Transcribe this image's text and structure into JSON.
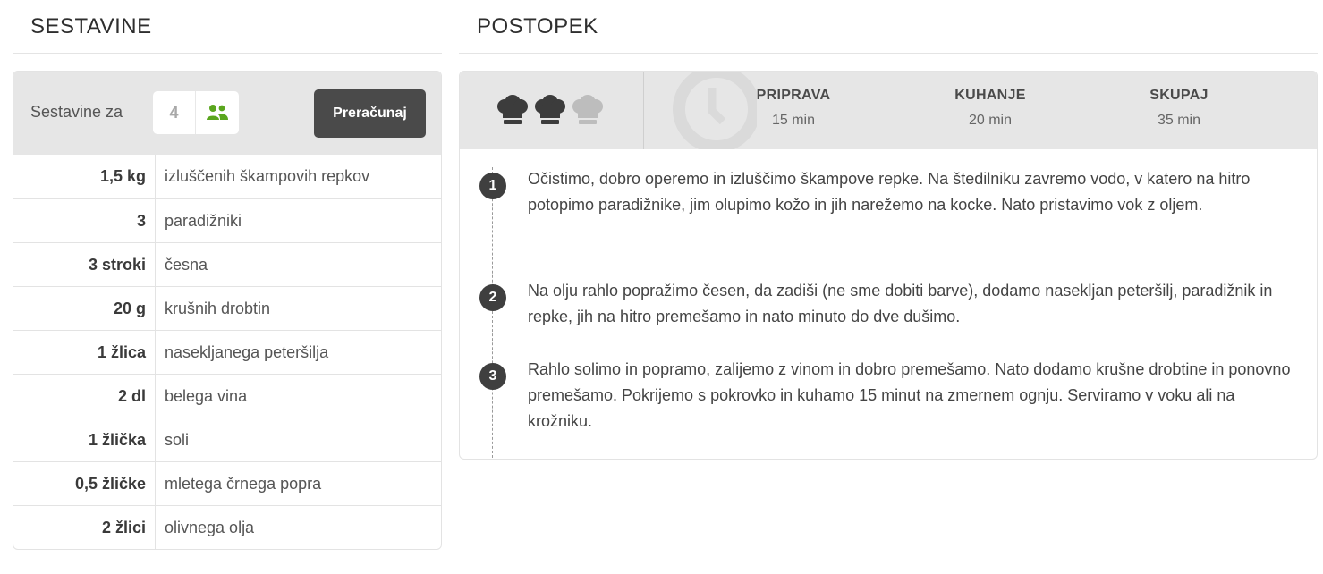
{
  "ingredients": {
    "title": "SESTAVINE",
    "servings_label": "Sestavine za",
    "servings_count": "4",
    "recalculate_label": "Preračunaj",
    "accent_color": "#5aa61e",
    "items": [
      {
        "qty": "1,5 kg",
        "name": "izluščenih škampovih repkov"
      },
      {
        "qty": "3",
        "name": "paradižniki"
      },
      {
        "qty": "3 stroki",
        "name": "česna"
      },
      {
        "qty": "20 g",
        "name": "krušnih drobtin"
      },
      {
        "qty": "1 žlica",
        "name": "nasekljanega peteršilja"
      },
      {
        "qty": "2 dl",
        "name": "belega vina"
      },
      {
        "qty": "1 žlička",
        "name": "soli"
      },
      {
        "qty": "0,5 žličke",
        "name": "mletega črnega popra"
      },
      {
        "qty": "2 žlici",
        "name": "olivnega olja"
      }
    ]
  },
  "procedure": {
    "title": "POSTOPEK",
    "difficulty": {
      "level": 2,
      "max": 3,
      "icon": "chef-hat-icon"
    },
    "times": [
      {
        "label": "PRIPRAVA",
        "value": "15 min"
      },
      {
        "label": "KUHANJE",
        "value": "20 min"
      },
      {
        "label": "SKUPAJ",
        "value": "35 min"
      }
    ],
    "steps": [
      {
        "num": "1",
        "text": "Očistimo, dobro operemo in izluščimo škampove repke. Na štedilniku zavremo vodo, v katero na hitro potopimo paradižnike, jim olupimo kožo in jih narežemo na kocke. Nato pristavimo vok z oljem."
      },
      {
        "num": "2",
        "text": "Na olju rahlo popražimo česen, da zadiši (ne sme dobiti barve), dodamo nasekljan peteršilj, paradižnik in repke, jih na hitro premešamo in nato minuto do dve dušimo."
      },
      {
        "num": "3",
        "text": "Rahlo solimo in popramo, zalijemo z vinom in dobro premešamo. Nato dodamo krušne drobtine in ponovno premešamo. Pokrijemo s pokrovko in kuhamo 15 minut na zmernem ognju. Serviramo v voku ali na krožniku."
      }
    ]
  }
}
